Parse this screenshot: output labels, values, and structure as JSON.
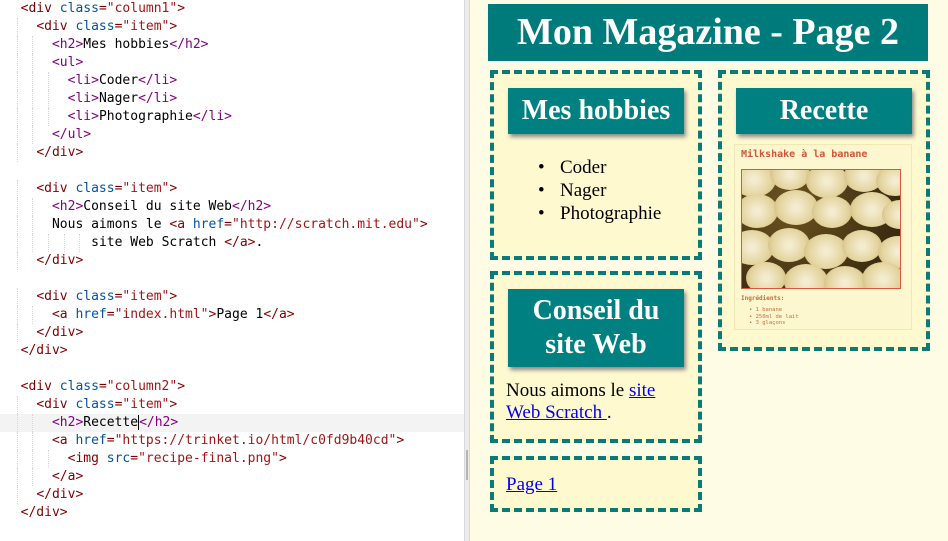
{
  "editor": {
    "lines": [
      {
        "indent": 2,
        "parts": [
          [
            "tag",
            "<div "
          ],
          [
            "attr",
            "class"
          ],
          [
            "tag",
            "="
          ],
          [
            "str",
            "\"column1\""
          ],
          [
            "tag",
            ">"
          ]
        ]
      },
      {
        "indent": 4,
        "parts": [
          [
            "tag",
            "<div "
          ],
          [
            "attr",
            "class"
          ],
          [
            "tag",
            "="
          ],
          [
            "str",
            "\"item\""
          ],
          [
            "tag",
            ">"
          ]
        ]
      },
      {
        "indent": 6,
        "parts": [
          [
            "c-tag",
            "<h2>"
          ],
          [
            "txt",
            "Mes hobbies"
          ],
          [
            "c-tag",
            "</h2>"
          ]
        ]
      },
      {
        "indent": 6,
        "parts": [
          [
            "c-tag",
            "<ul>"
          ]
        ]
      },
      {
        "indent": 8,
        "parts": [
          [
            "c-tag",
            "<li>"
          ],
          [
            "txt",
            "Coder"
          ],
          [
            "c-tag",
            "</li>"
          ]
        ]
      },
      {
        "indent": 8,
        "parts": [
          [
            "c-tag",
            "<li>"
          ],
          [
            "txt",
            "Nager"
          ],
          [
            "c-tag",
            "</li>"
          ]
        ]
      },
      {
        "indent": 8,
        "parts": [
          [
            "c-tag",
            "<li>"
          ],
          [
            "txt",
            "Photographie"
          ],
          [
            "c-tag",
            "</li>"
          ]
        ]
      },
      {
        "indent": 6,
        "parts": [
          [
            "c-tag",
            "</ul>"
          ]
        ]
      },
      {
        "indent": 4,
        "parts": [
          [
            "tag",
            "</div>"
          ]
        ]
      },
      {
        "indent": 0,
        "parts": []
      },
      {
        "indent": 4,
        "parts": [
          [
            "tag",
            "<div "
          ],
          [
            "attr",
            "class"
          ],
          [
            "tag",
            "="
          ],
          [
            "str",
            "\"item\""
          ],
          [
            "tag",
            ">"
          ]
        ]
      },
      {
        "indent": 6,
        "parts": [
          [
            "c-tag",
            "<h2>"
          ],
          [
            "txt",
            "Conseil du site Web"
          ],
          [
            "c-tag",
            "</h2>"
          ]
        ]
      },
      {
        "indent": 6,
        "parts": [
          [
            "txt",
            "Nous aimons le "
          ],
          [
            "tag",
            "<a "
          ],
          [
            "attr",
            "href"
          ],
          [
            "tag",
            "="
          ],
          [
            "str",
            "\"http://scratch.mit.edu\""
          ],
          [
            "tag",
            ">"
          ]
        ]
      },
      {
        "indent": 11,
        "parts": [
          [
            "txt",
            "site Web Scratch "
          ],
          [
            "tag",
            "</a>"
          ],
          [
            "txt",
            "."
          ]
        ]
      },
      {
        "indent": 4,
        "parts": [
          [
            "tag",
            "</div>"
          ]
        ]
      },
      {
        "indent": 0,
        "parts": []
      },
      {
        "indent": 4,
        "parts": [
          [
            "tag",
            "<div "
          ],
          [
            "attr",
            "class"
          ],
          [
            "tag",
            "="
          ],
          [
            "str",
            "\"item\""
          ],
          [
            "tag",
            ">"
          ]
        ]
      },
      {
        "indent": 6,
        "parts": [
          [
            "tag",
            "<a "
          ],
          [
            "attr",
            "href"
          ],
          [
            "tag",
            "="
          ],
          [
            "str",
            "\"index.html\""
          ],
          [
            "tag",
            ">"
          ],
          [
            "txt",
            "Page 1"
          ],
          [
            "tag",
            "</a>"
          ]
        ]
      },
      {
        "indent": 4,
        "parts": [
          [
            "tag",
            "</div>"
          ]
        ]
      },
      {
        "indent": 2,
        "parts": [
          [
            "tag",
            "</div>"
          ]
        ]
      },
      {
        "indent": 0,
        "parts": []
      },
      {
        "indent": 2,
        "parts": [
          [
            "tag",
            "<div "
          ],
          [
            "attr",
            "class"
          ],
          [
            "tag",
            "="
          ],
          [
            "str",
            "\"column2\""
          ],
          [
            "tag",
            ">"
          ]
        ]
      },
      {
        "indent": 4,
        "parts": [
          [
            "tag",
            "<div "
          ],
          [
            "attr",
            "class"
          ],
          [
            "tag",
            "="
          ],
          [
            "str",
            "\"item\""
          ],
          [
            "tag",
            ">"
          ]
        ]
      },
      {
        "indent": 6,
        "parts": [
          [
            "c-tag",
            "<h2>"
          ],
          [
            "txt",
            "Recette"
          ],
          [
            "c-tag",
            "</h2>"
          ]
        ],
        "cursor": true
      },
      {
        "indent": 6,
        "parts": [
          [
            "tag",
            "<a "
          ],
          [
            "attr",
            "href"
          ],
          [
            "tag",
            "="
          ],
          [
            "str",
            "\"https://trinket.io/html/c0fd9b40cd\""
          ],
          [
            "tag",
            ">"
          ]
        ]
      },
      {
        "indent": 8,
        "parts": [
          [
            "tag",
            "<img "
          ],
          [
            "attr",
            "src"
          ],
          [
            "tag",
            "="
          ],
          [
            "str",
            "\"recipe-final.png\""
          ],
          [
            "tag",
            ">"
          ]
        ]
      },
      {
        "indent": 6,
        "parts": [
          [
            "tag",
            "</a>"
          ]
        ]
      },
      {
        "indent": 4,
        "parts": [
          [
            "tag",
            "</div>"
          ]
        ]
      },
      {
        "indent": 2,
        "parts": [
          [
            "tag",
            "</div>"
          ]
        ]
      }
    ]
  },
  "preview": {
    "title": "Mon Magazine - Page 2",
    "hobbies": {
      "heading": "Mes hobbies",
      "items": [
        "Coder",
        "Nager",
        "Photographie"
      ]
    },
    "tip": {
      "heading_line1": "Conseil du",
      "heading_line2": "site Web",
      "text_before": "Nous aimons le ",
      "link_text": "site Web Scratch ",
      "text_after": "."
    },
    "page_link": "Page 1",
    "recipe": {
      "heading": "Recette",
      "card_title": "Milkshake à la banane",
      "ingredients_label": "Ingrédients:",
      "ingredients": [
        "1 banane",
        "250ml de lait",
        "3 glaçons"
      ]
    }
  },
  "colors": {
    "teal": "#008080",
    "dashed_border": "#0b7b78",
    "preview_bg": "#fefce4",
    "link": "#0000ee"
  }
}
